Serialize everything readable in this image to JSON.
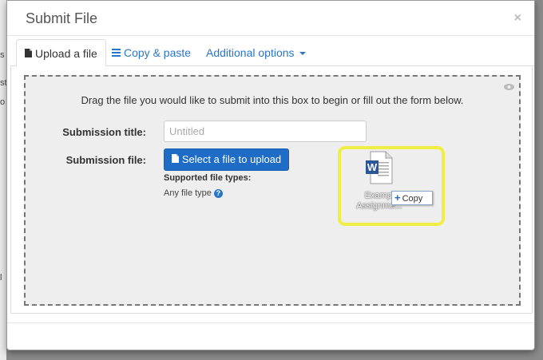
{
  "background": {
    "chars": [
      "s",
      "st",
      "o",
      "l"
    ]
  },
  "modal": {
    "title": "Submit File",
    "close": "×"
  },
  "tabs": [
    {
      "label": "Upload a file",
      "icon": "file-icon",
      "active": true
    },
    {
      "label": "Copy & paste",
      "icon": "list-icon",
      "active": false
    },
    {
      "label": "Additional options",
      "icon": "caret-down-icon",
      "active": false
    }
  ],
  "dropzone": {
    "instruction": "Drag the file you would like to submit into this box to begin or fill out the form below.",
    "title_label": "Submission title:",
    "title_placeholder": "Untitled",
    "file_label": "Submission file:",
    "select_button": "Select a file to upload",
    "supported_label": "Supported file types:",
    "any_type": "Any file type",
    "help": "?"
  },
  "dragged_file": {
    "name_line1": "Exampl",
    "name_line2": "Assignme...",
    "copy_label": "Copy",
    "highlight_color": "#f0ee44"
  },
  "colors": {
    "accent": "#2a76c6",
    "button": "#1f6cc7"
  }
}
